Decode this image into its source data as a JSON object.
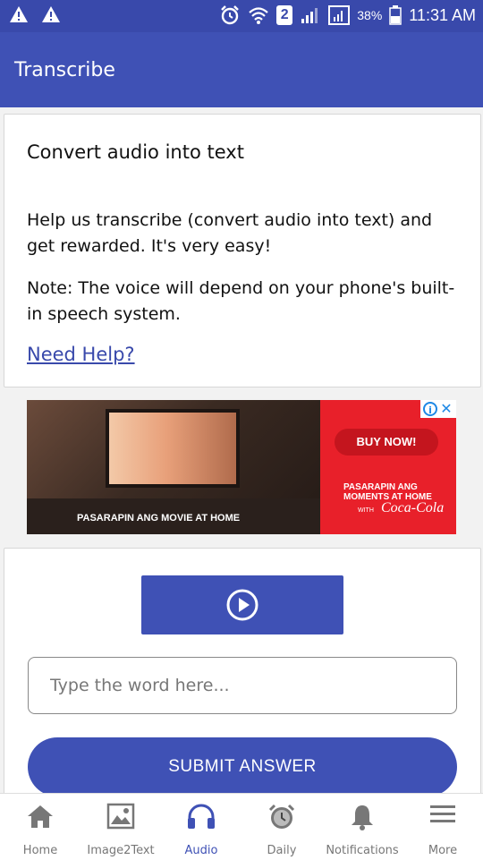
{
  "status_bar": {
    "sim_number": "2",
    "battery": "38%",
    "time": "11:31 AM"
  },
  "app_bar": {
    "title": "Transcribe"
  },
  "intro_card": {
    "title": "Convert audio into text",
    "body": "Help us transcribe (convert audio into text) and get rewarded. It's very easy!",
    "note": "Note: The voice will depend on your phone's built-in speech system.",
    "help_link": "Need Help?"
  },
  "ad": {
    "caption": "PASARAPIN ANG MOVIE AT HOME",
    "cta": "BUY NOW!",
    "tagline_1": "PASARAPIN ANG",
    "tagline_2": "MOMENTS AT HOME",
    "with": "WITH",
    "brand": "Coca-Cola"
  },
  "answer_card": {
    "input_placeholder": "Type the word here...",
    "input_value": "",
    "submit_label": "SUBMIT ANSWER"
  },
  "bottom_nav": {
    "items": [
      {
        "label": "Home",
        "icon": "home-icon",
        "active": false
      },
      {
        "label": "Image2Text",
        "icon": "image-icon",
        "active": false
      },
      {
        "label": "Audio",
        "icon": "headphones-icon",
        "active": true
      },
      {
        "label": "Daily",
        "icon": "alarm-clock-icon",
        "active": false
      },
      {
        "label": "Notifications",
        "icon": "bell-icon",
        "active": false
      },
      {
        "label": "More",
        "icon": "menu-icon",
        "active": false
      }
    ]
  },
  "colors": {
    "primary": "#3f51b5",
    "status_bar": "#3949ab",
    "ad_red": "#e8202a"
  }
}
